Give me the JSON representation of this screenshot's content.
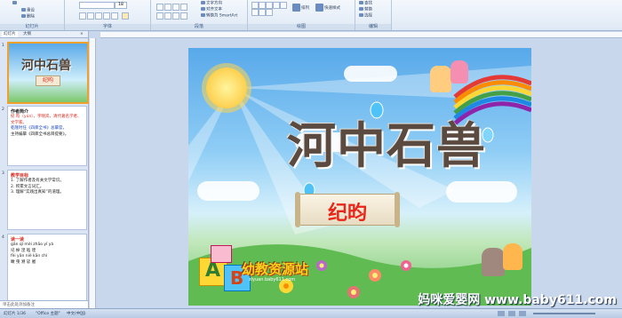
{
  "ribbon": {
    "groups": [
      {
        "label": "幻灯片"
      },
      {
        "label": "字体"
      },
      {
        "label": "段落"
      },
      {
        "label": "绘图"
      },
      {
        "label": "编辑"
      }
    ],
    "font_size_value": "18",
    "tools": {
      "reset": "重设",
      "delete": "删除",
      "text_direction": "文字方向",
      "align_text": "对齐文本",
      "smartart": "转换为 SmartArt",
      "arrange": "排列",
      "quick_styles": "快速样式",
      "find": "查找",
      "replace": "替换",
      "select": "选择"
    }
  },
  "pane": {
    "tabs": [
      "幻灯片",
      "大纲"
    ],
    "slides": [
      {
        "num": "1",
        "title": "河中石兽",
        "subtitle": "纪昀"
      },
      {
        "num": "2",
        "heading": "作者简介",
        "lines": [
          "纪 昀（yún），字晓岚，清代著名学者、文学家。",
          "乾隆时任《四库全书》总纂官，",
          "主持编纂《四库全书总目提要》。"
        ]
      },
      {
        "num": "3",
        "heading": "教学目标",
        "lines": [
          "1. 了解作者及有关文学常识。",
          "2. 积累文言词汇。",
          "3. 理解“实践出真知”的道理。"
        ]
      },
      {
        "num": "4",
        "heading": "读一读",
        "pinyin": [
          "gǎn  qǐ  mèi  zhāo  yǐ  yá",
          "fèi  yān  niè  kān  chì"
        ],
        "words": [
          "圮  棹  湮  啮  堙",
          "瞰  曳  溯  欤  阇"
        ]
      }
    ],
    "notes": "单击此处添加备注"
  },
  "slide": {
    "title": "河中石兽",
    "author": "纪昀",
    "logo": "幼教资源站",
    "logo_url": "ziyuan.baby611.com"
  },
  "watermark": "妈咪爱婴网 www.baby611.com",
  "status": {
    "slide_info": "幻灯片 1/36",
    "theme": "\"Office 主题\"",
    "language": "中文(中国)"
  },
  "colors": {
    "title_text": "#5a4a3f",
    "author_text": "#e8261a",
    "ribbon_bg": "#dfe9f5",
    "selected_thumb_border": "#f0a02c"
  }
}
